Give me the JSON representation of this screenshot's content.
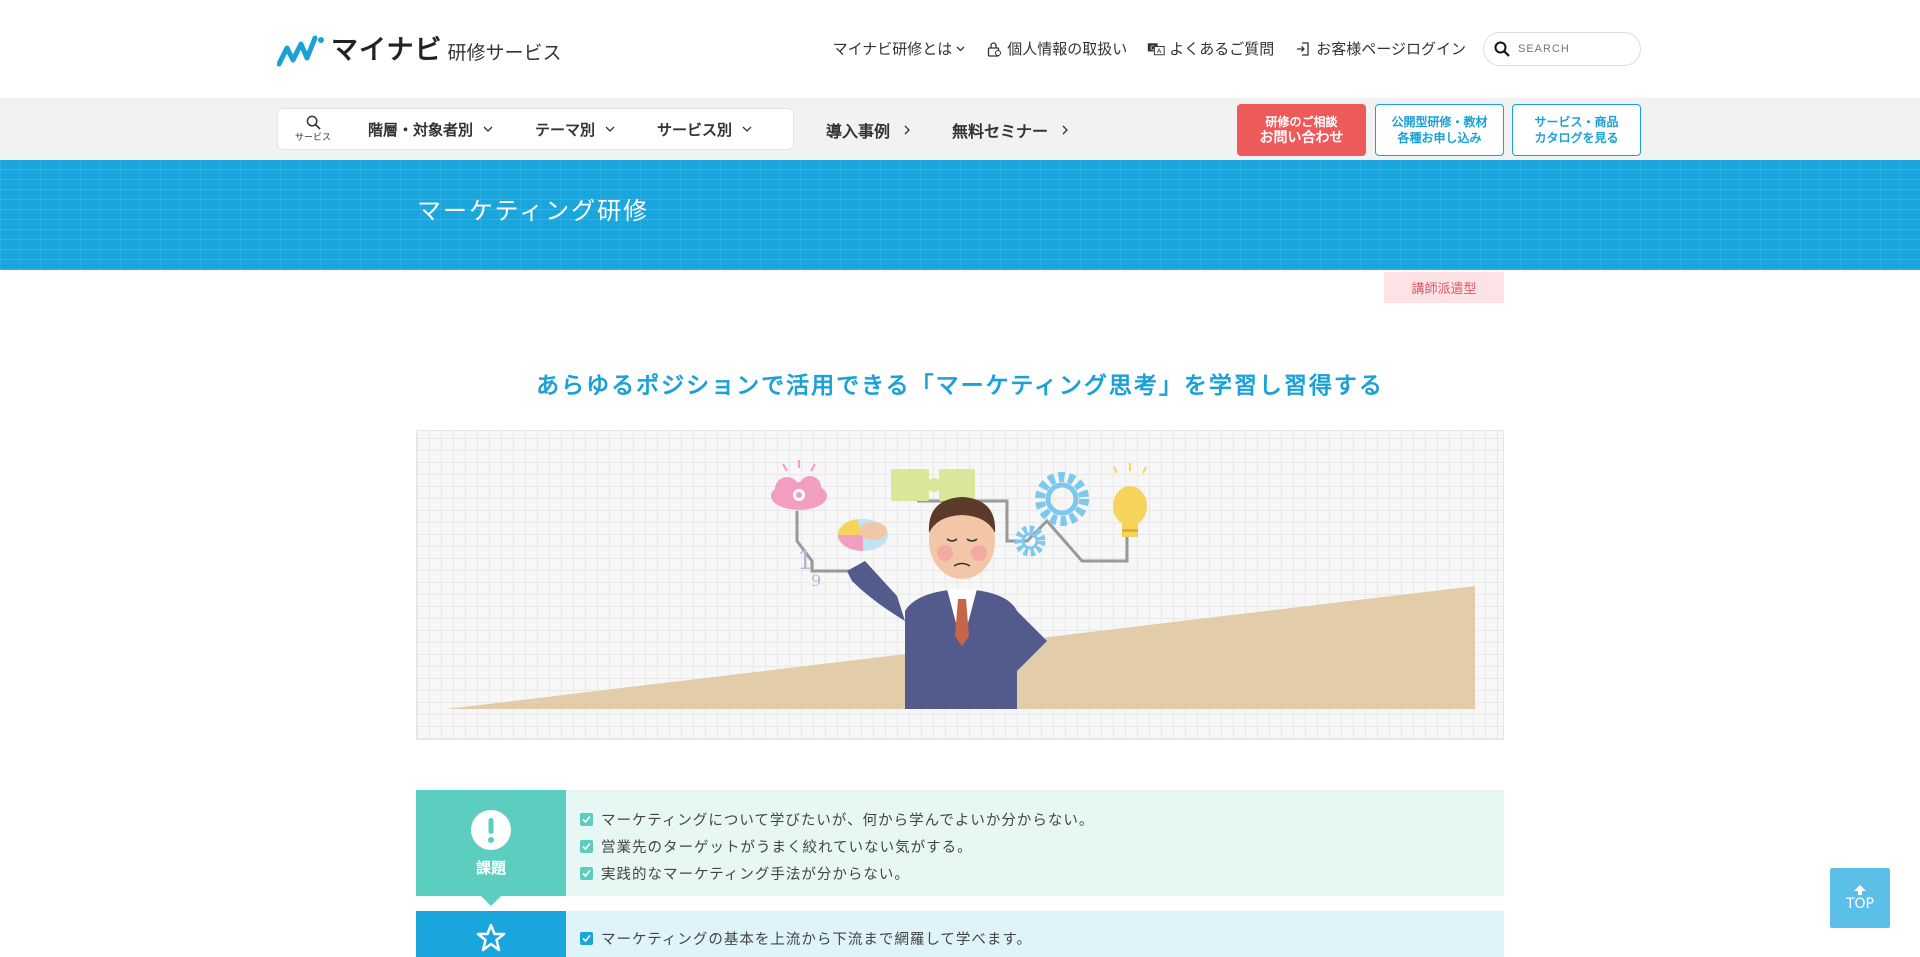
{
  "header": {
    "logo_main": "マイナビ",
    "logo_sub": "研修サービス",
    "nav": [
      {
        "label": "マイナビ研修とは",
        "icon": "chevron-down-icon"
      },
      {
        "label": "個人情報の取扱い",
        "icon": "lock-icon"
      },
      {
        "label": "よくあるご質問",
        "icon": "faq-icon"
      },
      {
        "label": "お客様ページログイン",
        "icon": "login-icon"
      }
    ],
    "search_placeholder": "SEARCH"
  },
  "navbar": {
    "service_label": "サービス",
    "dropdowns": [
      "階層・対象者別",
      "テーマ別",
      "サービス別"
    ],
    "links": [
      "導入事例",
      "無料セミナー"
    ],
    "cta_contact": {
      "small": "研修のご相談",
      "big": "お問い合わせ"
    },
    "cta_apply": {
      "line1": "公開型研修・教材",
      "line2": "各種お申し込み"
    },
    "cta_catalog": {
      "line1": "サービス・商品",
      "line2": "カタログを見る"
    }
  },
  "banner": {
    "title": "マーケティング研修"
  },
  "tag": "講師派遣型",
  "headline": "あらゆるポジションで活用できる「マーケティング思考」を学習し習得する",
  "illustration": {
    "numbers": [
      "1",
      "9"
    ]
  },
  "issue": {
    "label": "課題",
    "items": [
      "マーケティングについて学びたいが、何から学んでよいか分からない。",
      "営業先のターゲットがうまく絞れていない気がする。",
      "実践的なマーケティング手法が分からない。"
    ]
  },
  "goal": {
    "items": [
      "マーケティングの基本を上流から下流まで網羅して学べます。"
    ]
  },
  "top_button": "TOP",
  "colors": {
    "accent": "#1aa1d8",
    "teal": "#5ccec0",
    "red": "#ee5a5a"
  }
}
